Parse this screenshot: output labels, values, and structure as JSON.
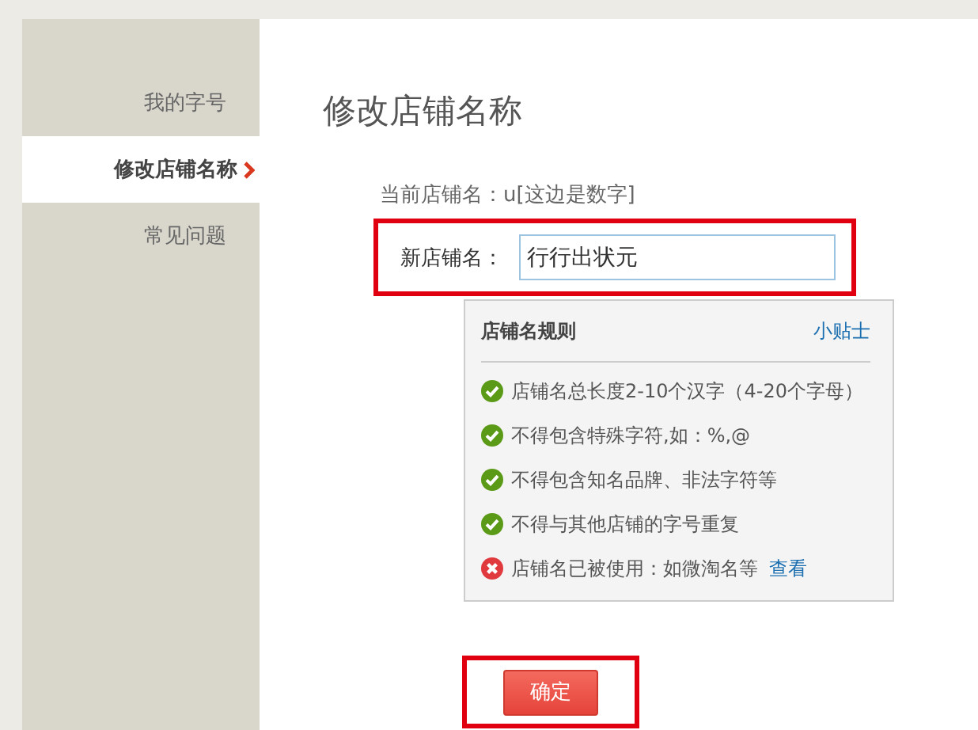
{
  "sidebar": {
    "items": [
      {
        "label": "我的字号",
        "selected": false
      },
      {
        "label": "修改店铺名称",
        "selected": true
      },
      {
        "label": "常见问题",
        "selected": false
      }
    ]
  },
  "title": "修改店铺名称",
  "current_name": {
    "label": "当前店铺名：",
    "value": "u[这边是数字]"
  },
  "new_name": {
    "label": "新店铺名：",
    "value": "行行出状元"
  },
  "rules": {
    "title": "店铺名规则",
    "tips_link": "小贴士",
    "items": [
      {
        "kind": "ok",
        "text": "店铺名总长度2-10个汉字（4-20个字母）"
      },
      {
        "kind": "ok",
        "text": "不得包含特殊字符,如：%,@"
      },
      {
        "kind": "ok",
        "text": "不得包含知名品牌、非法字符等"
      },
      {
        "kind": "ok",
        "text": "不得与其他店铺的字号重复"
      },
      {
        "kind": "error",
        "text": "店铺名已被使用：如微淘名等",
        "link": "查看"
      }
    ]
  },
  "submit": "确定"
}
